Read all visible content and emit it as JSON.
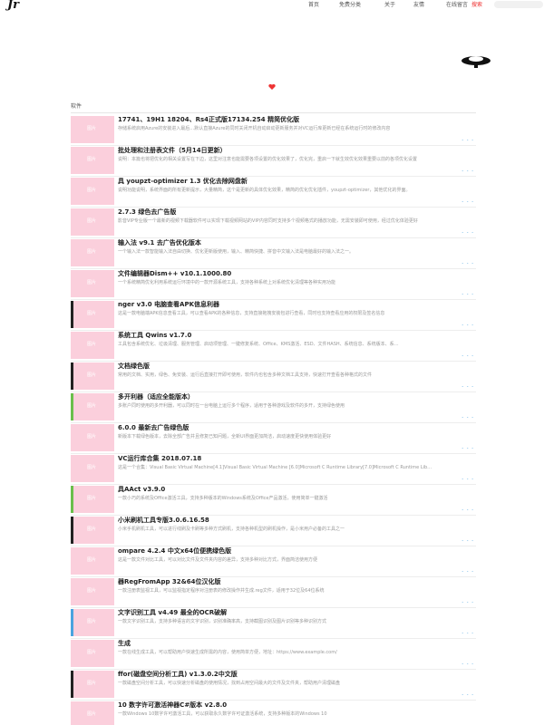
{
  "header": {
    "logo_text": "Jr",
    "nav": [
      {
        "label": "首页",
        "active": false
      },
      {
        "label": "免费分类",
        "active": false
      },
      {
        "label": "关于",
        "active": false
      },
      {
        "label": "友情",
        "active": false
      },
      {
        "label": "在线留言",
        "active": false
      },
      {
        "label": "搜索",
        "active": true
      }
    ]
  },
  "section": {
    "label": "软件"
  },
  "thumb_label": "图片",
  "more_label": "- - -",
  "posts": [
    {
      "title": "17741、19H1 18204、Rs4正式版17134.254 精简优化版",
      "excerpt": "存储系统启用Azure的安装进入最后…默认直接Azure的同时关闭开机自动启动更新服务并对VC运行库更新已经在系统运行时的修改内容",
      "thumb_bar": "#fbcfdc"
    },
    {
      "title": "批处理和注册表文件（5月14日更新）",
      "excerpt": "说明：本篇也将把优化的相关设置写在下边，这里对注意也能需要各项设置的优化效果了，优化完，重启一下就生效优化效果重要以前的各项优化设置",
      "thumb_bar": "#fbcfdc"
    },
    {
      "title": "具 youpzt-optimizer 1.3 优化去除网盘新",
      "excerpt": "说明功能说明，系统界面的所有更新提示，大量精简，这个是更新的具体优化效果，精简的优化优化插件，youpzt-optimizer，其他优化的界面。",
      "thumb_bar": "#fbcfdc"
    },
    {
      "title": "2.7.3 绿色去广告版",
      "excerpt": "影音VIP专业版一个最新的视频下载器软件可以实现下载视频网站的VIP内容同时支持多个视频格式的播放功能，无需安装即可使用，经过优化体验更好",
      "thumb_bar": "#fbcfdc"
    },
    {
      "title": "输入法 v9.1 去广告优化版本",
      "excerpt": "一个输入法一款智能输入法自由切换、优化更新版使用，输入、精简快捷、拼音中文输入法是电脑最好的输入法之一。",
      "thumb_bar": "#fbcfdc"
    },
    {
      "title": "文件编辑器Dism++ v10.1.1000.80",
      "excerpt": "一个系统精简优化利用系统运行环境中的一款开源系统工具，支持各种系统上对系统优化清理等各种实用功能",
      "thumb_bar": "#fbcfdc"
    },
    {
      "title": "nger v3.0 电脑查看APK信息利器",
      "excerpt": "这是一款电脑端APK信息查看工具，可以查看APK的各种信息，支持直接拖拽安装包进行查看，同时也支持查看应用的权限及签名信息",
      "thumb_bar": "#222222"
    },
    {
      "title": "系统工具 Qwins v1.7.0",
      "excerpt": "工具包含系统优化、垃圾清理、服务管理、启动项管理、一键修复系统、Office、KMS激活、ESD、文件HASH、系统信息、系统版本、系…",
      "thumb_bar": "#fbcfdc"
    },
    {
      "title": "文档绿色版",
      "excerpt": "常用的文档、实用，绿色、免安装、运行后直接打开即可使用，软件内也包含多种文档工具支持，快速打开查看各种格式的文件",
      "thumb_bar": "#222222"
    },
    {
      "title": "多开利器（适应全能版本）",
      "excerpt": "多账户同时使用的多开利器，可以同时在一台电脑上运行多个程序，适用于各种游戏及软件的多开，支持绿色使用",
      "thumb_bar": "#6abf4b"
    },
    {
      "title": "6.0.0 最新去广告绿色版",
      "excerpt": "新版本下载绿色版本，去除全部广告并且修复已知问题，全新UI界面更加简洁，启动速度更快使用体验更好",
      "thumb_bar": "#fbcfdc"
    },
    {
      "title": "VC运行库合集 2018.07.18",
      "excerpt": "这是一个合集：Visual Basic Virtual Machine[4.1]Visual Basic Virtual Machine [6.0]Microsoft C Runtime Library[7.0]Microsoft C Runtime Lib…",
      "thumb_bar": "#fbcfdc"
    },
    {
      "title": "具AAct v3.9.0",
      "excerpt": "一款小巧的系统及Office激活工具，支持多种版本的Windows系统及Office产品激活，使用简单一键激活",
      "thumb_bar": "#6abf4b"
    },
    {
      "title": "小米刷机工具专版3.0.6.16.58",
      "excerpt": "小米手机刷机工具，可以进行线刷及卡刷等多种方式刷机，支持各种机型的刷机操作，是小米用户必备的工具之一",
      "thumb_bar": "#222222"
    },
    {
      "title": "ompare 4.2.4 中文x64位便携绿色版",
      "excerpt": "这是一款文件对比工具，可以对比文件及文件夹内容的差异，支持多种对比方式，界面简洁使用方便",
      "thumb_bar": "#fbcfdc"
    },
    {
      "title": "器RegFromApp 32&64位汉化版",
      "excerpt": "一款注册表监视工具，可以监视指定程序对注册表的修改操作并生成.reg文件，适用于32位及64位系统",
      "thumb_bar": "#fbcfdc"
    },
    {
      "title": "文字识别工具 v4.49 最全的OCR破解",
      "excerpt": "一款文字识别工具，支持多种语言的文字识别，识别准确率高，支持截图识别及图片识别等多种识别方式",
      "thumb_bar": "#4aa3df"
    },
    {
      "title": "生成",
      "excerpt": "一款在线生成工具，可以帮助用户快速生成所需的内容，使用简单方便，地址：https://www.example.com/",
      "thumb_bar": "#fbcfdc"
    },
    {
      "title": "ffor(磁盘空间分析工具) v1.3.0.2中文版",
      "excerpt": "一款磁盘空间分析工具，可以快速分析磁盘的使用情况，找到占用空间最大的文件及文件夹，帮助用户清理磁盘",
      "thumb_bar": "#222222"
    },
    {
      "title": "10 数字许可激活神器C#版本 v2.8.0",
      "excerpt": "一款Windows 10数字许可激活工具，可以获取永久数字许可证激活系统，支持多种版本的Windows 10",
      "thumb_bar": "#fbcfdc"
    }
  ]
}
